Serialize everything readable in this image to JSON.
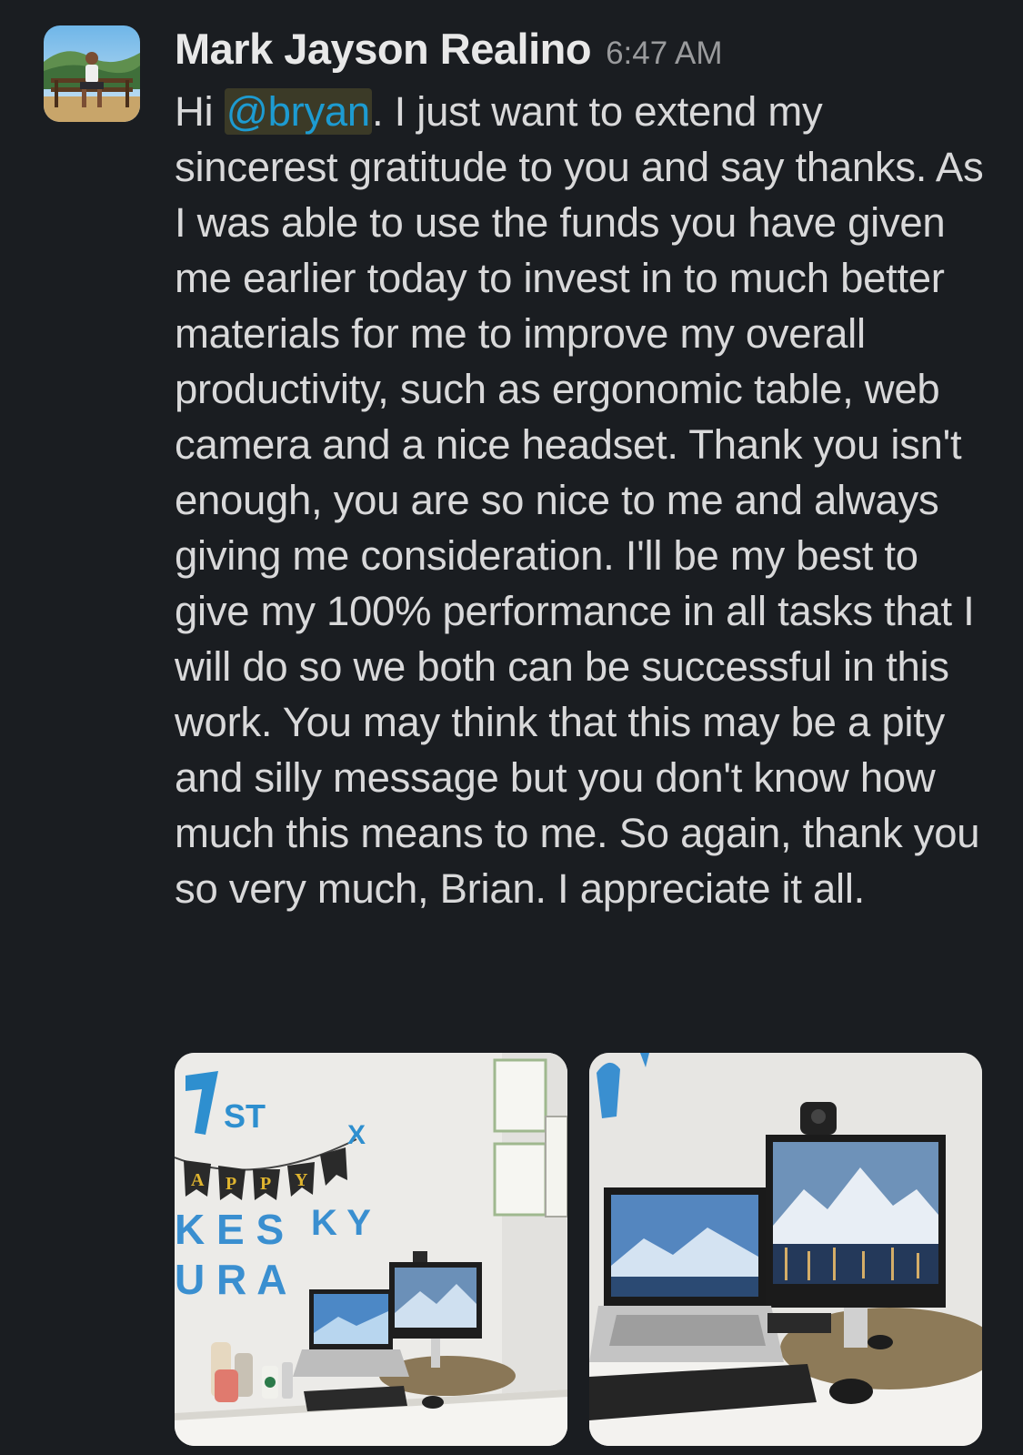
{
  "message": {
    "sender": "Mark Jayson Realino",
    "timestamp": "6:47 AM",
    "text_before_mention": "Hi ",
    "mention": "@bryan",
    "text_after_mention": ". I just want to extend my sincerest gratitude to you and say thanks. As I was able to use the funds you have given me earlier today to invest in to much better materials for me to improve my overall productivity, such as ergonomic table, web camera and a nice headset. Thank you isn't enough, you are so nice to me and always giving me consideration. I'll be my best to give my 100% performance in all tasks that I will do so we both can be successful in this work. You may think that this may be a pity and silly message but you don't know how much this means to me. So again, thank you so very much, Brian. I appreciate it all.",
    "attachments": [
      {
        "name": "desk-setup-photo-wide",
        "icon": "image-photo"
      },
      {
        "name": "desk-setup-photo-closeup",
        "icon": "image-photo"
      }
    ]
  },
  "colors": {
    "background": "#1a1d21",
    "text": "#d9d9da",
    "mention": "#1d9bd1",
    "mention_bg": "#3b3a27",
    "timestamp": "#9a9b9d"
  }
}
